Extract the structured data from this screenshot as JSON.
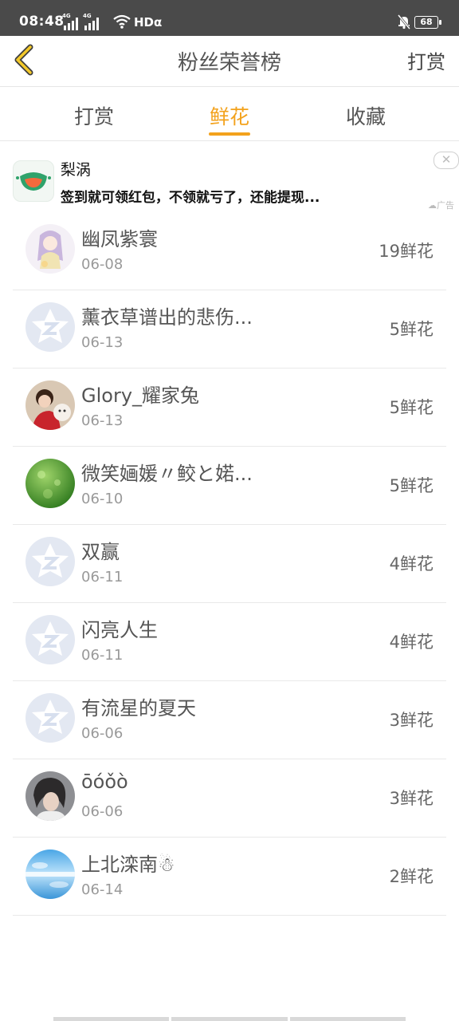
{
  "status": {
    "time": "08:48",
    "signal_tag": "4G",
    "network": "HDα",
    "battery": "68"
  },
  "header": {
    "title": "粉丝荣誉榜",
    "action": "打赏"
  },
  "tabs": [
    {
      "label": "打赏",
      "active": false
    },
    {
      "label": "鲜花",
      "active": true
    },
    {
      "label": "收藏",
      "active": false
    }
  ],
  "ad": {
    "name": "梨涡",
    "desc": "签到就可领红包，不领就亏了，还能提现...",
    "tag": "广告"
  },
  "list": [
    {
      "name": "幽凤紫寰",
      "date": "06-08",
      "count": "19鲜花",
      "avatar": "anime-girl"
    },
    {
      "name": "薰衣草谱出的悲伤...",
      "date": "06-13",
      "count": "5鲜花",
      "avatar": "default-qq"
    },
    {
      "name": "Glory_耀家兔",
      "date": "06-13",
      "count": "5鲜花",
      "avatar": "red-costume"
    },
    {
      "name": "微笑婳媛〃鲛と婼...",
      "date": "06-10",
      "count": "5鲜花",
      "avatar": "green-bokeh"
    },
    {
      "name": "双赢",
      "date": "06-11",
      "count": "4鲜花",
      "avatar": "default-qq"
    },
    {
      "name": "闪亮人生",
      "date": "06-11",
      "count": "4鲜花",
      "avatar": "default-qq"
    },
    {
      "name": "有流星的夏天",
      "date": "06-06",
      "count": "3鲜花",
      "avatar": "default-qq"
    },
    {
      "name": "ōóǒò",
      "date": "06-06",
      "count": "3鲜花",
      "avatar": "dark-portrait"
    },
    {
      "name": "上北滦南☃",
      "date": "06-14",
      "count": "2鲜花",
      "avatar": "blue-sky"
    }
  ],
  "colors": {
    "accent": "#f3a21c",
    "status_bar": "#4a4a4a"
  }
}
